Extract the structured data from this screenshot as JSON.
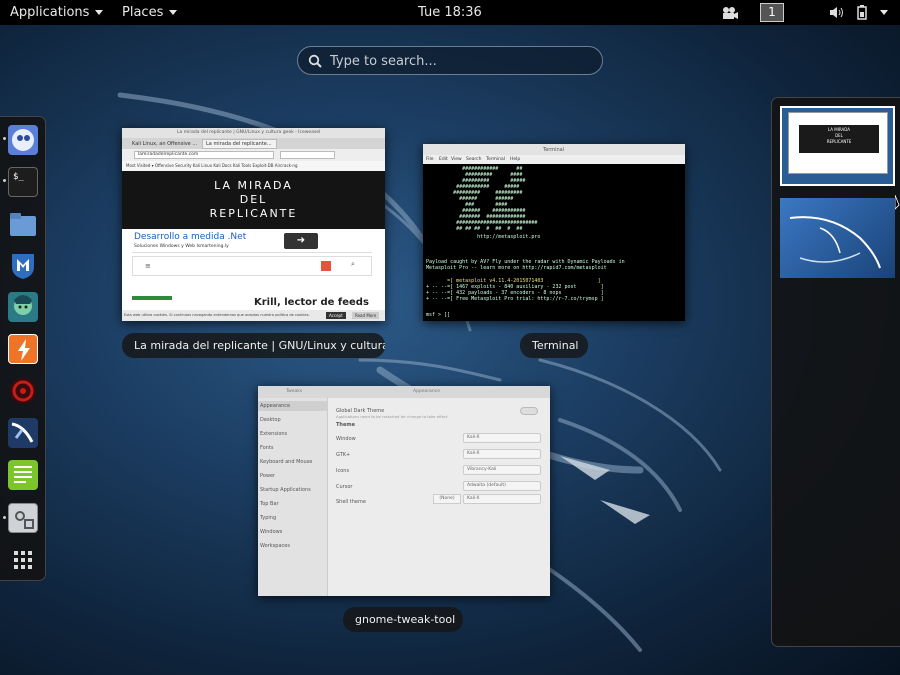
{
  "topbar": {
    "applications": "Applications",
    "places": "Places",
    "clock": "Tue 18:36",
    "workspace_number": "1"
  },
  "search": {
    "placeholder": "Type to search..."
  },
  "dash": {
    "apps": [
      "iceweasel",
      "terminal",
      "files",
      "metasploit",
      "armitage",
      "burp-suite",
      "maltego",
      "kali-tools",
      "gedit",
      "tweak-tool",
      "show-applications"
    ]
  },
  "windows": {
    "browser": {
      "caption": "La mirada del replicante | GNU/Linux y cultura ...",
      "title": "La mirada del replicante | GNU/Linux y cultura geek - Iceweasel",
      "tab1": "Kali Linux, an Offensive ...",
      "tab2": "La mirada del replicante...",
      "url": "lamiradadelreplicante.com",
      "bookmarks": "Most Visited ▾  Offensive Security  Kali Linux  Kali Docs  Kali Tools  Exploit-DB  Aircrack-ng",
      "site_title": [
        "LA MIRADA",
        "DEL",
        "REPLICANTE"
      ],
      "ad_title": "Desarrollo a medida .Net",
      "ad_text": "Soluciones Windows y Web Ismartening.ly",
      "article": "Krill, lector de feeds con",
      "cookie_text": "Esta web utiliza cookies. Si continúas navegando entendemos que aceptas nuestra política de cookies.",
      "cookie_btn": "Accept",
      "more_btn": "Read More"
    },
    "terminal": {
      "caption": "Terminal",
      "title": "Terminal",
      "menu": [
        "File",
        "Edit",
        "View",
        "Search",
        "Terminal",
        "Help"
      ],
      "ascii": [
        "            ############      ##",
        "             #########      ####",
        "            #########       #####",
        "          ###########     #####",
        "         #########     #########",
        "           ######      ######",
        "             ###       ####",
        "            ######    ###########",
        "           #######  #############",
        "          ###########################",
        "          ## ## ##  #  ##  #  ##",
        "                 http://metasploit.pro"
      ],
      "payload_lines": [
        "Payload caught by AV? Fly under the radar with Dynamic Payloads in",
        "Metasploit Pro -- learn more on http://rapid7.com/metasploit"
      ],
      "banner": [
        "       =[ metasploit v4.11.4-2015071403                  ]",
        "+ -- --=[ 1467 exploits - 840 auxiliary - 232 post        ]",
        "+ -- --=[ 432 payloads - 37 encoders - 8 nops             ]",
        "+ -- --=[ Free Metasploit Pro trial: http://r-7.co/trymsp ]"
      ],
      "prompt": "msf > []"
    },
    "tweak": {
      "caption": "gnome-tweak-tool",
      "header_left": "Tweaks",
      "header_right": "Appearance",
      "sidebar": [
        "Appearance",
        "Desktop",
        "Extensions",
        "Fonts",
        "Keyboard and Mouse",
        "Power",
        "Startup Applications",
        "Top Bar",
        "Typing",
        "Windows",
        "Workspaces"
      ],
      "global_dark": "Global Dark Theme",
      "global_dark_sub": "Applications need to be restarted for change to take effect",
      "theme_heading": "Theme",
      "rows": [
        {
          "label": "Window",
          "value": "Kali-X"
        },
        {
          "label": "GTK+",
          "value": "Kali-X"
        },
        {
          "label": "Icons",
          "value": "Vibrancy-Kali"
        },
        {
          "label": "Cursor",
          "value": "Adwaita (default)"
        },
        {
          "label": "Shell theme",
          "value": "Kali-X"
        }
      ],
      "none_btn": "(None)"
    }
  },
  "colors": {
    "topbar_bg": "#000000",
    "kali_blue": "#1c3e63",
    "dash_bg": "#121212",
    "selection": "#ffffff"
  }
}
